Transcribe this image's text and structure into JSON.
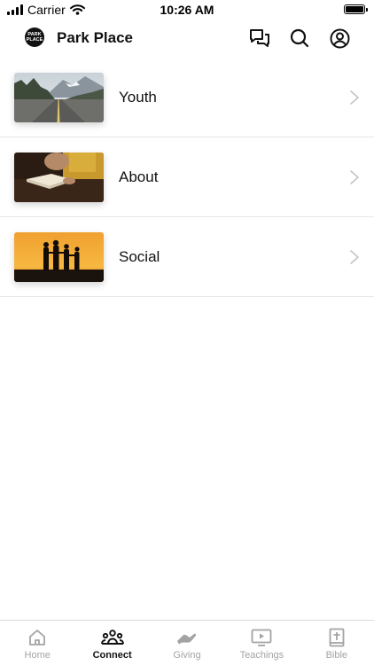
{
  "status_bar": {
    "carrier": "Carrier",
    "time": "10:26 AM"
  },
  "header": {
    "title": "Park Place",
    "logo_text": [
      "PARK",
      "PLACE"
    ]
  },
  "items": [
    {
      "label": "Youth",
      "image": "road-through-mountains"
    },
    {
      "label": "About",
      "image": "person-holding-bible"
    },
    {
      "label": "Social",
      "image": "group-silhouette-sunset"
    }
  ],
  "tabs": [
    {
      "label": "Home",
      "icon": "home-icon",
      "active": false
    },
    {
      "label": "Connect",
      "icon": "people-icon",
      "active": true
    },
    {
      "label": "Giving",
      "icon": "giving-hand-icon",
      "active": false
    },
    {
      "label": "Teachings",
      "icon": "play-screen-icon",
      "active": false
    },
    {
      "label": "Bible",
      "icon": "bible-icon",
      "active": false
    }
  ],
  "colors": {
    "active": "#111111",
    "inactive": "#a3a3a3",
    "divider": "#e6e6e6"
  }
}
